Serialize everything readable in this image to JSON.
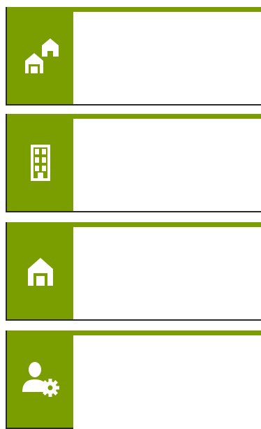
{
  "theme": {
    "accent": "#7a9e00",
    "border": "#2a2a2a",
    "icon_color": "#ffffff"
  },
  "tiles": [
    {
      "icon": "houses-icon",
      "label": ""
    },
    {
      "icon": "building-icon",
      "label": ""
    },
    {
      "icon": "home-icon",
      "label": ""
    },
    {
      "icon": "user-settings-icon",
      "label": ""
    }
  ]
}
